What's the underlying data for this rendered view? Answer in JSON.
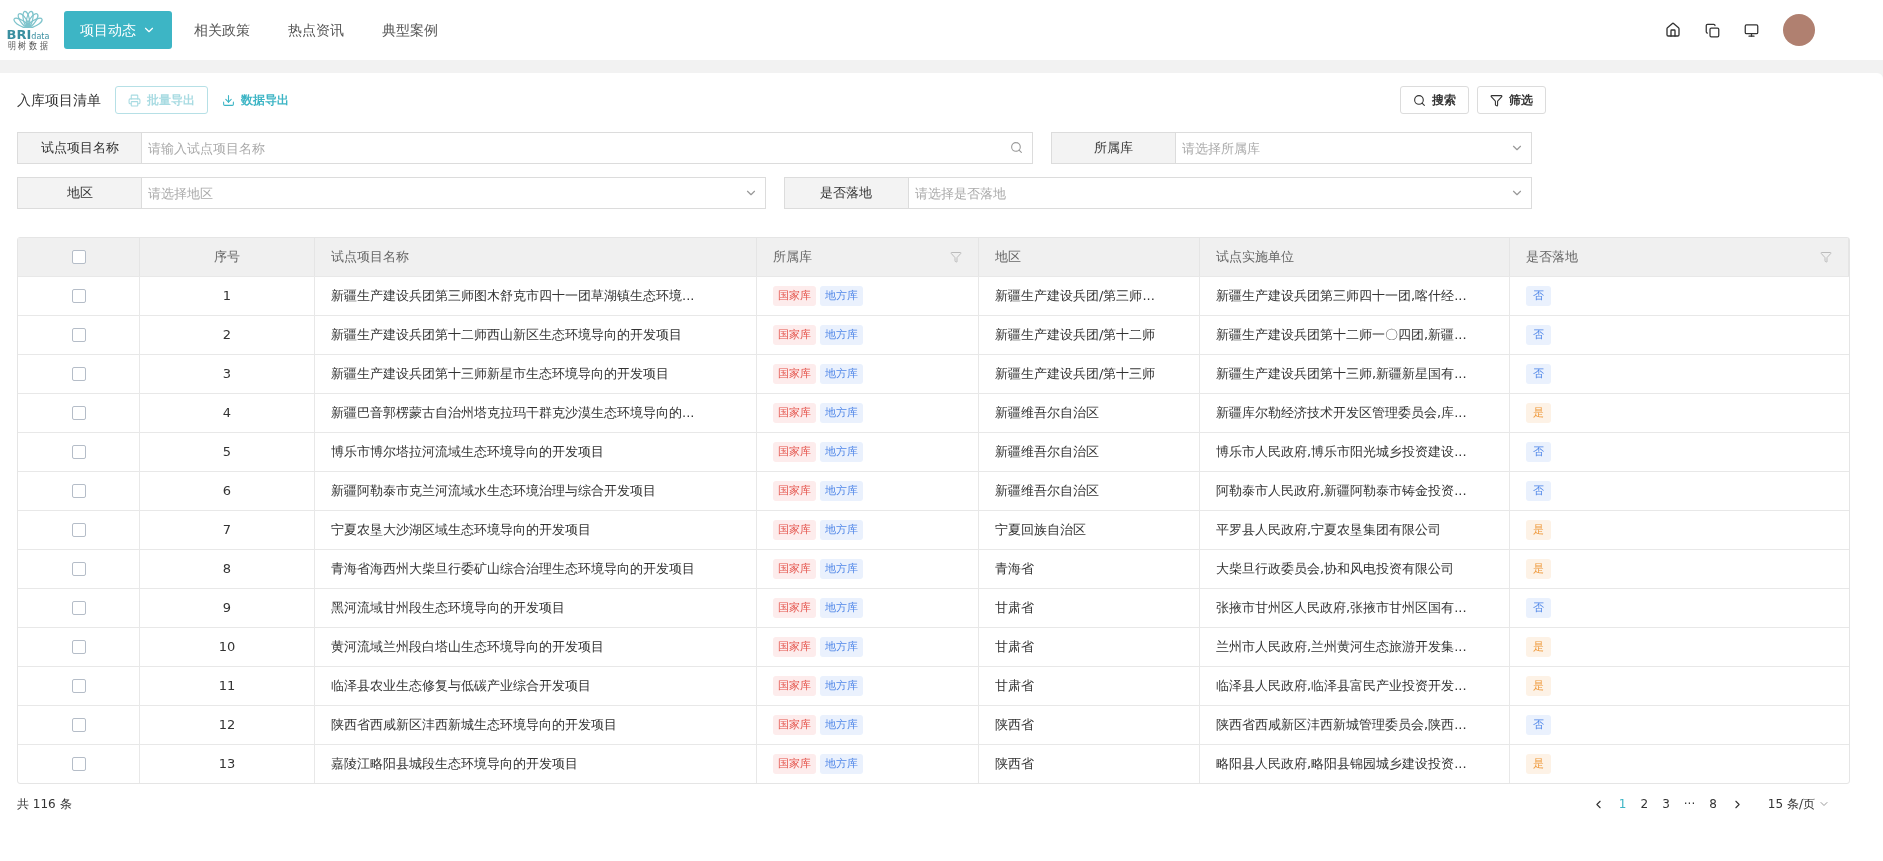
{
  "logo": {
    "mark": "BRI",
    "sub": "data",
    "caption": "明 树 数 据"
  },
  "nav": [
    {
      "label": "项目动态",
      "selected": true,
      "dropdown": true
    },
    {
      "label": "相关政策",
      "selected": false,
      "dropdown": false
    },
    {
      "label": "热点资讯",
      "selected": false,
      "dropdown": false
    },
    {
      "label": "典型案例",
      "selected": false,
      "dropdown": false
    }
  ],
  "toolbar": {
    "title": "入库项目清单",
    "batch_export": {
      "label": "批量导出",
      "disabled": true
    },
    "data_export": {
      "label": "数据导出"
    },
    "search": "搜索",
    "filter": "筛选"
  },
  "filter_rows": [
    [
      {
        "label": "试点项目名称",
        "placeholder": "请输入试点项目名称",
        "kind": "input"
      },
      {
        "label": "所属库",
        "placeholder": "请选择所属库",
        "kind": "select"
      }
    ],
    [
      {
        "label": "地区",
        "placeholder": "请选择地区",
        "kind": "select"
      },
      {
        "label": "是否落地",
        "placeholder": "请选择是否落地",
        "kind": "select"
      }
    ]
  ],
  "table": {
    "all_checked": false,
    "columns": [
      {
        "label": "序号",
        "filter_icon": false
      },
      {
        "label": "试点项目名称",
        "filter_icon": false
      },
      {
        "label": "所属库",
        "filter_icon": true
      },
      {
        "label": "地区",
        "filter_icon": false
      },
      {
        "label": "试点实施单位",
        "filter_icon": false
      },
      {
        "label": "是否落地",
        "filter_icon": true
      }
    ],
    "rows": [
      {
        "checked": false,
        "no": "1",
        "name": "新疆生产建设兵团第三师图木舒克市四十一团草湖镇生态环境...",
        "tags": [
          {
            "text": "国家库",
            "kind": "national"
          },
          {
            "text": "地方库",
            "kind": "local"
          }
        ],
        "region": "新疆生产建设兵团/第三师...",
        "unit": "新疆生产建设兵团第三师四十一团,喀什经...",
        "landed": {
          "text": "否",
          "kind": "no"
        }
      },
      {
        "checked": false,
        "no": "2",
        "name": "新疆生产建设兵团第十二师西山新区生态环境导向的开发项目",
        "tags": [
          {
            "text": "国家库",
            "kind": "national"
          },
          {
            "text": "地方库",
            "kind": "local"
          }
        ],
        "region": "新疆生产建设兵团/第十二师",
        "unit": "新疆生产建设兵团第十二师一〇四团,新疆...",
        "landed": {
          "text": "否",
          "kind": "no"
        }
      },
      {
        "checked": false,
        "no": "3",
        "name": "新疆生产建设兵团第十三师新星市生态环境导向的开发项目",
        "tags": [
          {
            "text": "国家库",
            "kind": "national"
          },
          {
            "text": "地方库",
            "kind": "local"
          }
        ],
        "region": "新疆生产建设兵团/第十三师",
        "unit": "新疆生产建设兵团第十三师,新疆新星国有...",
        "landed": {
          "text": "否",
          "kind": "no"
        }
      },
      {
        "checked": false,
        "no": "4",
        "name": "新疆巴音郭楞蒙古自治州塔克拉玛干群克沙漠生态环境导向的...",
        "tags": [
          {
            "text": "国家库",
            "kind": "national"
          },
          {
            "text": "地方库",
            "kind": "local"
          }
        ],
        "region": "新疆维吾尔自治区",
        "unit": "新疆库尔勒经济技术开发区管理委员会,库...",
        "landed": {
          "text": "是",
          "kind": "yes"
        }
      },
      {
        "checked": false,
        "no": "5",
        "name": "博乐市博尔塔拉河流域生态环境导向的开发项目",
        "tags": [
          {
            "text": "国家库",
            "kind": "national"
          },
          {
            "text": "地方库",
            "kind": "local"
          }
        ],
        "region": "新疆维吾尔自治区",
        "unit": "博乐市人民政府,博乐市阳光城乡投资建设...",
        "landed": {
          "text": "否",
          "kind": "no"
        }
      },
      {
        "checked": false,
        "no": "6",
        "name": "新疆阿勒泰市克兰河流域水生态环境治理与综合开发项目",
        "tags": [
          {
            "text": "国家库",
            "kind": "national"
          },
          {
            "text": "地方库",
            "kind": "local"
          }
        ],
        "region": "新疆维吾尔自治区",
        "unit": "阿勒泰市人民政府,新疆阿勒泰市铸金投资...",
        "landed": {
          "text": "否",
          "kind": "no"
        }
      },
      {
        "checked": false,
        "no": "7",
        "name": "宁夏农垦大沙湖区域生态环境导向的开发项目",
        "tags": [
          {
            "text": "国家库",
            "kind": "national"
          },
          {
            "text": "地方库",
            "kind": "local"
          }
        ],
        "region": "宁夏回族自治区",
        "unit": "平罗县人民政府,宁夏农垦集团有限公司",
        "landed": {
          "text": "是",
          "kind": "yes"
        }
      },
      {
        "checked": false,
        "no": "8",
        "name": "青海省海西州大柴旦行委矿山综合治理生态环境导向的开发项目",
        "tags": [
          {
            "text": "国家库",
            "kind": "national"
          },
          {
            "text": "地方库",
            "kind": "local"
          }
        ],
        "region": "青海省",
        "unit": "大柴旦行政委员会,协和风电投资有限公司",
        "landed": {
          "text": "是",
          "kind": "yes"
        }
      },
      {
        "checked": false,
        "no": "9",
        "name": "黑河流域甘州段生态环境导向的开发项目",
        "tags": [
          {
            "text": "国家库",
            "kind": "national"
          },
          {
            "text": "地方库",
            "kind": "local"
          }
        ],
        "region": "甘肃省",
        "unit": "张掖市甘州区人民政府,张掖市甘州区国有...",
        "landed": {
          "text": "否",
          "kind": "no"
        }
      },
      {
        "checked": false,
        "no": "10",
        "name": "黄河流域兰州段白塔山生态环境导向的开发项目",
        "tags": [
          {
            "text": "国家库",
            "kind": "national"
          },
          {
            "text": "地方库",
            "kind": "local"
          }
        ],
        "region": "甘肃省",
        "unit": "兰州市人民政府,兰州黄河生态旅游开发集...",
        "landed": {
          "text": "是",
          "kind": "yes"
        }
      },
      {
        "checked": false,
        "no": "11",
        "name": "临泽县农业生态修复与低碳产业综合开发项目",
        "tags": [
          {
            "text": "国家库",
            "kind": "national"
          },
          {
            "text": "地方库",
            "kind": "local"
          }
        ],
        "region": "甘肃省",
        "unit": "临泽县人民政府,临泽县富民产业投资开发...",
        "landed": {
          "text": "是",
          "kind": "yes"
        }
      },
      {
        "checked": false,
        "no": "12",
        "name": "陕西省西咸新区沣西新城生态环境导向的开发项目",
        "tags": [
          {
            "text": "国家库",
            "kind": "national"
          },
          {
            "text": "地方库",
            "kind": "local"
          }
        ],
        "region": "陕西省",
        "unit": "陕西省西咸新区沣西新城管理委员会,陕西...",
        "landed": {
          "text": "否",
          "kind": "no"
        }
      },
      {
        "checked": false,
        "no": "13",
        "name": "嘉陵江略阳县城段生态环境导向的开发项目",
        "tags": [
          {
            "text": "国家库",
            "kind": "national"
          },
          {
            "text": "地方库",
            "kind": "local"
          }
        ],
        "region": "陕西省",
        "unit": "略阳县人民政府,略阳县锦园城乡建设投资...",
        "landed": {
          "text": "是",
          "kind": "yes"
        }
      }
    ]
  },
  "footer": {
    "total": "共 116 条",
    "pages": [
      {
        "label": "1",
        "selected": true
      },
      {
        "label": "2",
        "selected": false
      },
      {
        "label": "3",
        "selected": false
      },
      {
        "label": "···",
        "selected": false
      },
      {
        "label": "8",
        "selected": false
      }
    ],
    "page_size": "15 条/页"
  }
}
